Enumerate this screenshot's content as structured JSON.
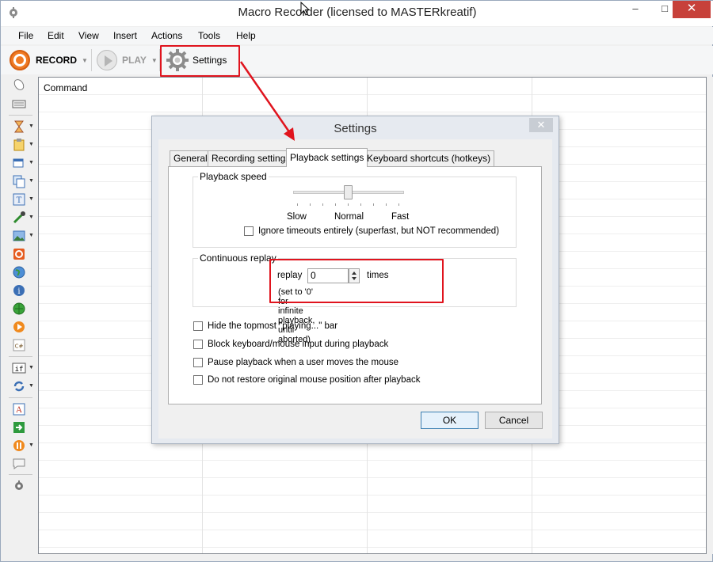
{
  "window": {
    "title": "Macro Recorder (licensed to MASTERkreatif)",
    "min": "–",
    "max": "□",
    "close": "✕"
  },
  "menu": [
    "File",
    "Edit",
    "View",
    "Insert",
    "Actions",
    "Tools",
    "Help"
  ],
  "toolbar": {
    "record": "RECORD",
    "play": "PLAY",
    "settings": "Settings",
    "dropdown": "▼"
  },
  "grid": {
    "column_header": "Command"
  },
  "dialog": {
    "title": "Settings",
    "close": "✕",
    "tabs": [
      "General",
      "Recording settings",
      "Playback settings",
      "Keyboard shortcuts (hotkeys)"
    ],
    "active_tab": "Playback settings",
    "playback_speed": {
      "label": "Playback speed",
      "labels": [
        "Slow",
        "Normal",
        "Fast"
      ],
      "value": "Normal",
      "ignore_timeouts": "Ignore timeouts entirely (superfast, but NOT recommended)"
    },
    "continuous_replay": {
      "label": "Continuous replay",
      "replay": "replay",
      "value": "0",
      "times": "times",
      "hint": "(set to '0' for infinite playback, until aborted)"
    },
    "options": [
      "Hide the topmost \"playing...\" bar",
      "Block keyboard/mouse input during playback",
      "Pause playback when a user moves the mouse",
      "Do not restore original mouse position after playback"
    ],
    "ok": "OK",
    "cancel": "Cancel"
  },
  "colors": {
    "accent_red": "#e0141e",
    "record_orange": "#f07a24",
    "close_red": "#c7413a"
  }
}
